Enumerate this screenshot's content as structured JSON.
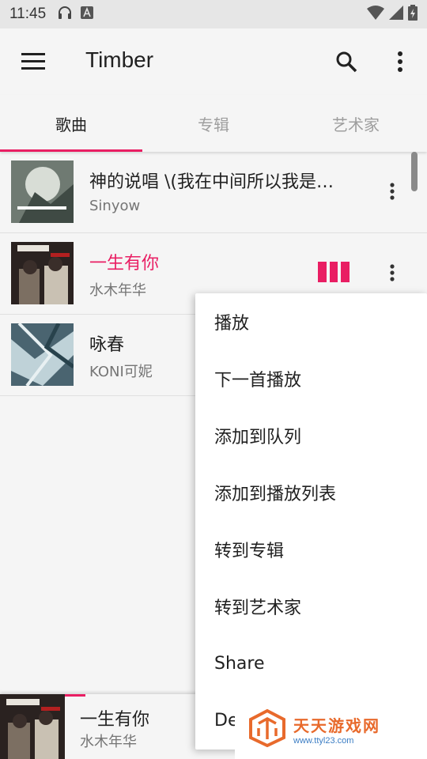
{
  "status_bar": {
    "time": "11:45"
  },
  "app_bar": {
    "title": "Timber"
  },
  "tabs": [
    {
      "label": "歌曲",
      "active": true
    },
    {
      "label": "专辑",
      "active": false
    },
    {
      "label": "艺术家",
      "active": false
    }
  ],
  "songs": [
    {
      "title": "神的说唱 \\(我在中间所以我是…",
      "artist": "Sinyow",
      "playing": false
    },
    {
      "title": "一生有你",
      "artist": "水木年华",
      "playing": true
    },
    {
      "title": "咏春",
      "artist": "KONI可妮",
      "playing": false
    }
  ],
  "context_menu": {
    "items": [
      "播放",
      "下一首播放",
      "添加到队列",
      "添加到播放列表",
      "转到专辑",
      "转到艺术家",
      "Share",
      "Delete"
    ]
  },
  "now_playing": {
    "title": "一生有你",
    "artist": "水木年华",
    "progress": 0.2
  },
  "watermark": {
    "title": "天天游戏网",
    "url": "www.ttyl23.com"
  },
  "colors": {
    "accent": "#e91e63",
    "background": "#f5f5f5"
  }
}
